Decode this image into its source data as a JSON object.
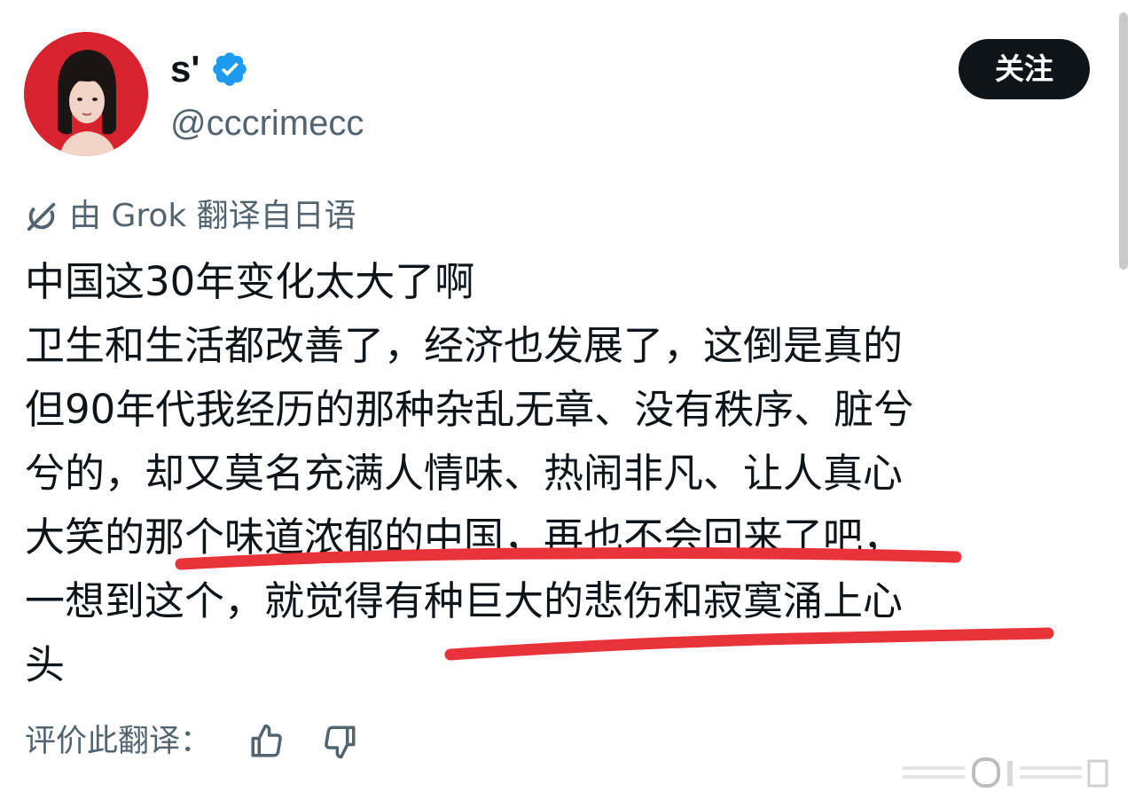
{
  "author": {
    "display_name": "s'",
    "handle": "@cccrimecc",
    "verified": true
  },
  "follow_button": {
    "label": "关注"
  },
  "translation_notice": {
    "icon": "translate-icon",
    "text": "由 Grok 翻译自日语"
  },
  "post": {
    "lines": [
      "中国这30年变化太大了啊",
      "卫生和生活都改善了，经济也发展了，这倒是真的",
      "但90年代我经历的那种杂乱无章、没有秩序、脏兮",
      "兮的，却又莫名充满人情味、热闹非凡、让人真心",
      "大笑的那个味道浓郁的中国，再也不会回来了吧，",
      "一想到这个，就觉得有种巨大的悲伤和寂寞涌上心",
      "头"
    ]
  },
  "rating": {
    "label": "评价此翻译：",
    "like_icon": "thumbs-up-icon",
    "dislike_icon": "thumbs-down-icon"
  },
  "colors": {
    "text_primary": "#0f1419",
    "text_secondary": "#536471",
    "follow_bg": "#0f1419",
    "verified_blue": "#1d9bf0",
    "avatar_bg": "#d8232e",
    "underline_red": "#e8333a"
  }
}
